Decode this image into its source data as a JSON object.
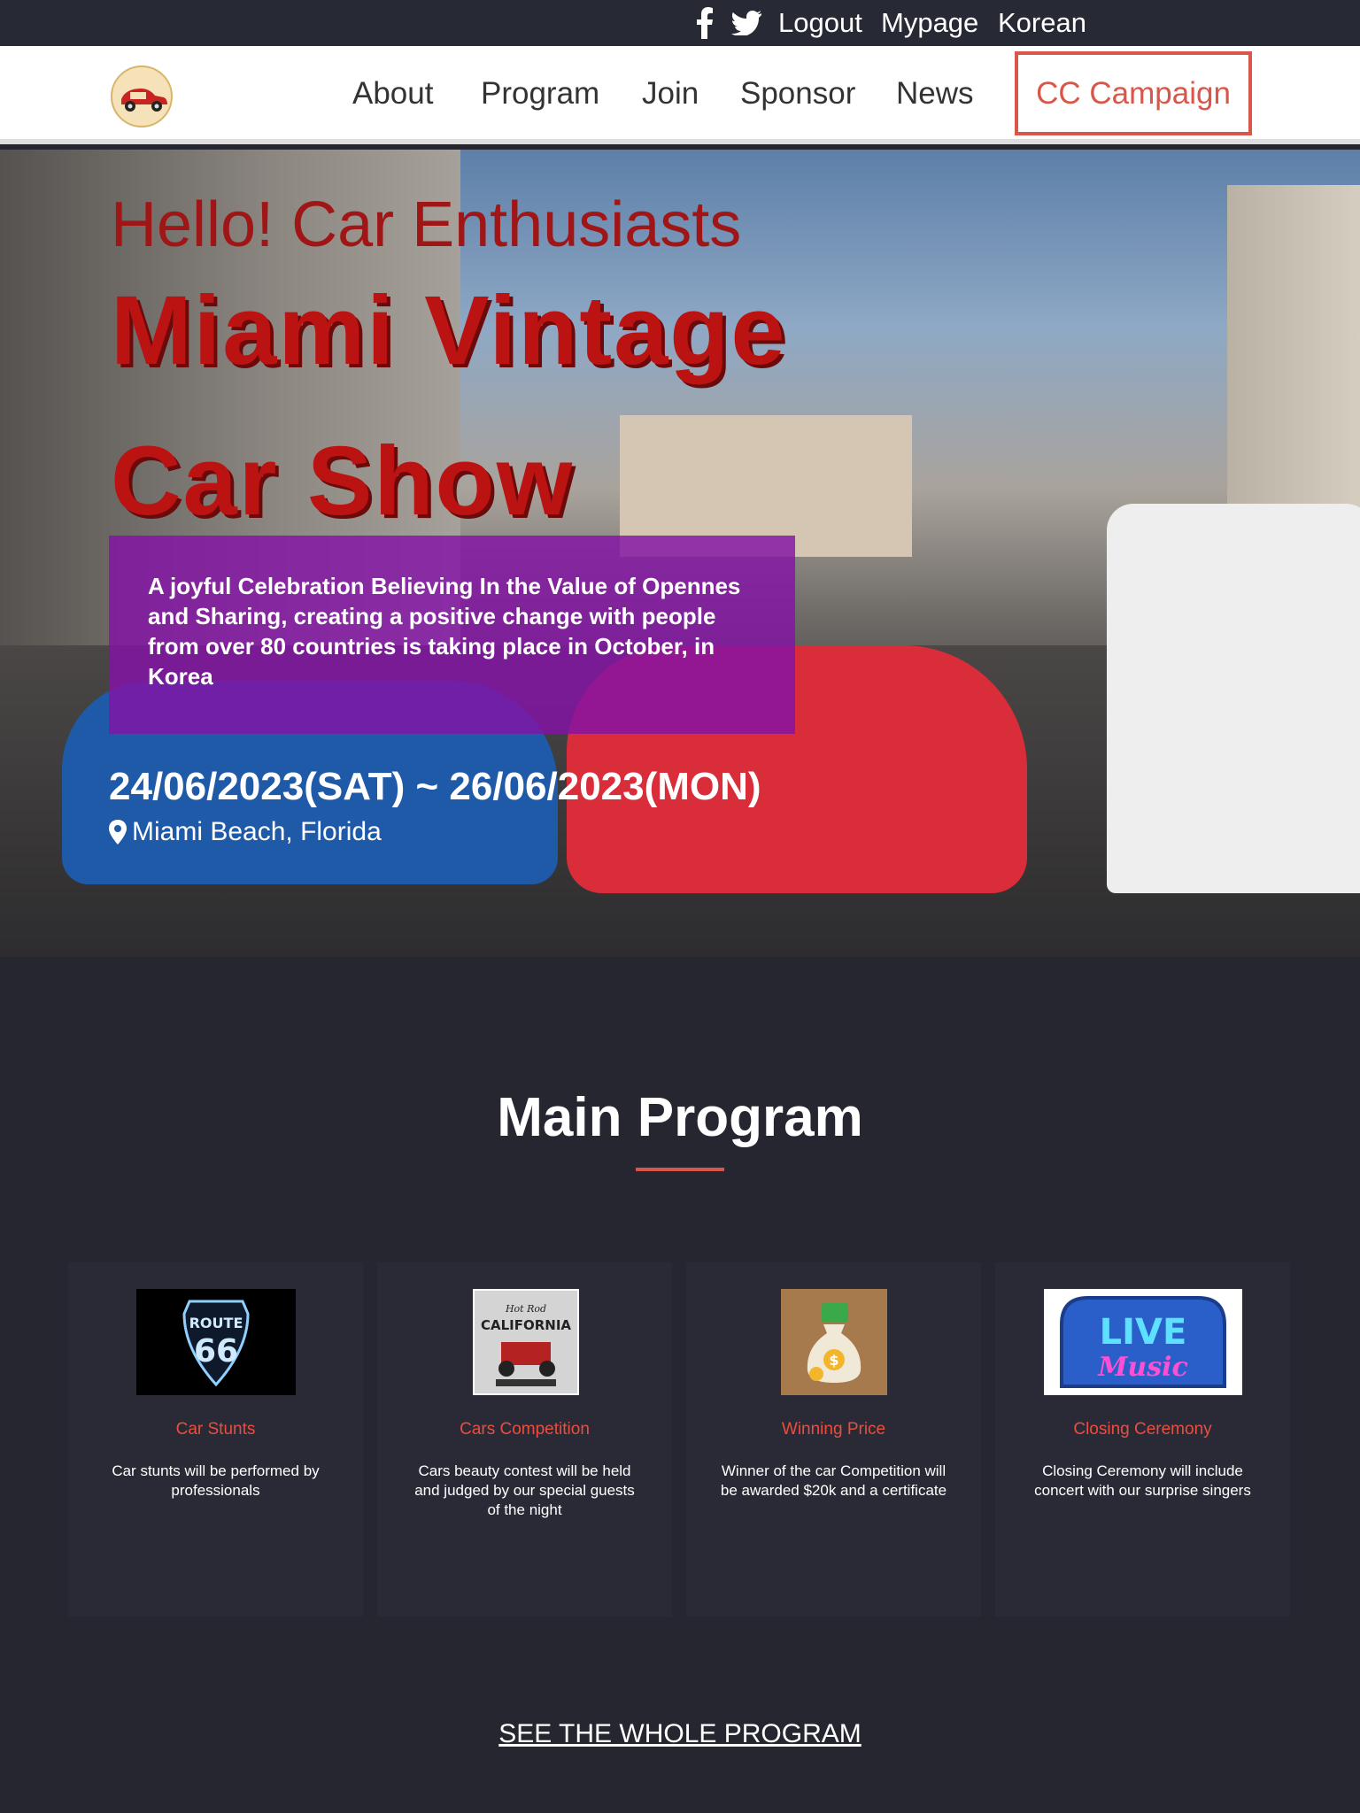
{
  "topbar": {
    "facebook_icon": "facebook-icon",
    "twitter_icon": "twitter-icon",
    "logout": "Logout",
    "mypage": "Mypage",
    "language": "Korean"
  },
  "nav": {
    "logo_icon": "retro-car-logo",
    "items": [
      "About",
      "Program",
      "Join",
      "Sponsor",
      "News"
    ],
    "cta": "CC Campaign",
    "cta_color": "#d9574a"
  },
  "hero": {
    "greeting": "Hello! Car Enthusiasts",
    "title_line1": "Miami Vintage",
    "title_line2": "Car Show",
    "description": "A joyful Celebration Believing In the Value of Opennes and Sharing, creating a positive change with people from over 80 countries is taking place in October, in Korea",
    "dates": "24/06/2023(SAT) ~ 26/06/2023(MON)",
    "location": "Miami Beach, Florida",
    "location_icon": "map-pin-icon",
    "panel_color": "#8412a6",
    "title_color": "#bb1212"
  },
  "program": {
    "title": "Main Program",
    "accent": "#d9574a",
    "cards": [
      {
        "image": "route-66-sign",
        "title": "Car Stunts",
        "description": "Car stunts will be performed by professionals"
      },
      {
        "image": "hot-rod-california-poster",
        "title": "Cars Competition",
        "description": "Cars beauty contest will be held and judged by our special guests of the night"
      },
      {
        "image": "money-bag",
        "title": "Winning Price",
        "description": "Winner of the car Competition will be awarded $20k and a certificate"
      },
      {
        "image": "live-music-sign",
        "title": "Closing Ceremony",
        "description": "Closing Ceremony will include concert with our surprise singers"
      }
    ],
    "see_all": "SEE THE WHOLE PROGRAM"
  }
}
